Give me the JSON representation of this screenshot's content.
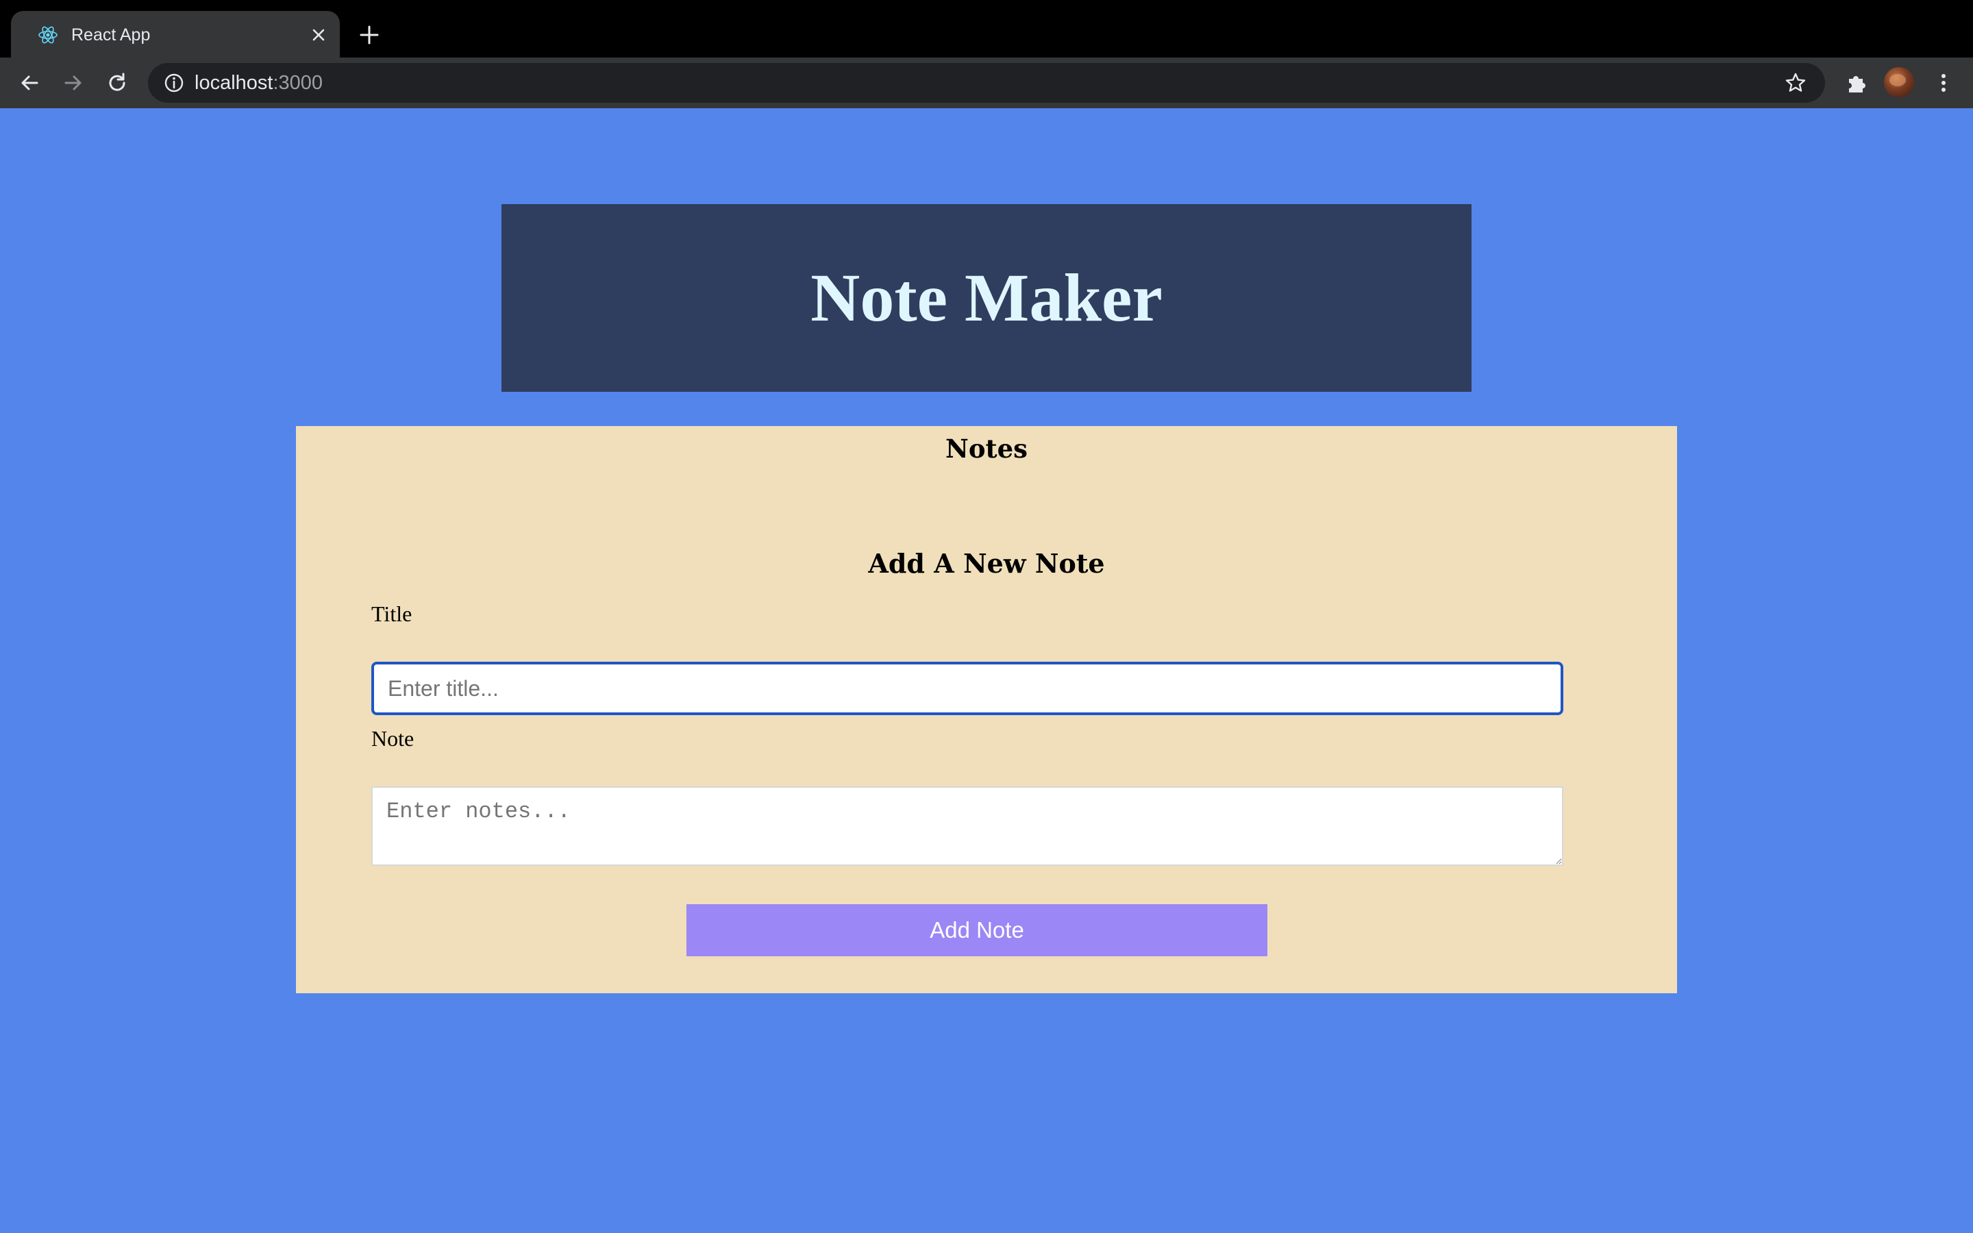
{
  "browser": {
    "tab": {
      "title": "React App",
      "favicon": "react-logo-icon"
    },
    "address_bar": {
      "host": "localhost",
      "port": ":3000"
    },
    "icons": [
      "back-arrow-icon",
      "forward-arrow-icon",
      "reload-icon",
      "info-icon",
      "star-icon",
      "puzzle-extension-icon",
      "avatar",
      "kebab-menu-icon"
    ],
    "colors": {
      "tabstrip": "#000000",
      "toolbar": "#353638",
      "omnibox": "#202124"
    }
  },
  "app": {
    "title": "Note Maker",
    "notes_section": {
      "heading": "Notes"
    },
    "form": {
      "heading": "Add A New Note",
      "title_label": "Title",
      "title_placeholder": "Enter title...",
      "note_label": "Note",
      "note_placeholder": "Enter notes...",
      "submit_label": "Add Note"
    },
    "colors": {
      "page_background": "#5385eb",
      "header_background": "#2f3d5e",
      "header_text": "#dff6ff",
      "panel_background": "#f0dfba",
      "button_background": "#9b87f5",
      "input_focus_border": "#1f56c6"
    }
  }
}
